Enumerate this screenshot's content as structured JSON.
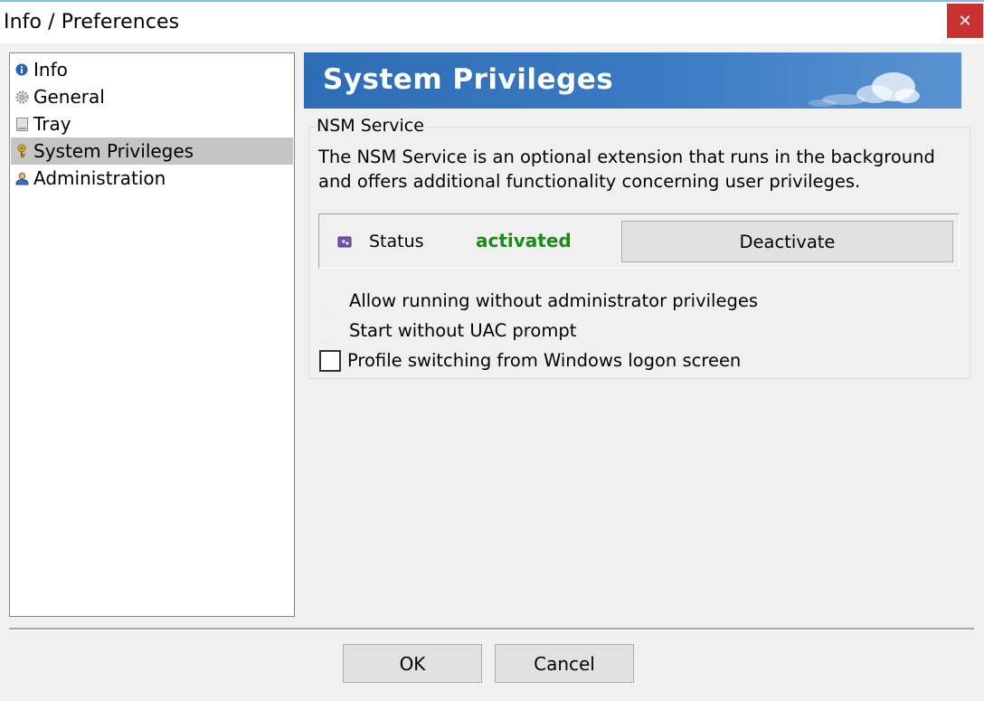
{
  "window": {
    "title": "Info / Preferences",
    "close_glyph": "✕"
  },
  "nav": {
    "items": [
      {
        "label": "Info",
        "icon": "info-icon"
      },
      {
        "label": "General",
        "icon": "gear-icon"
      },
      {
        "label": "Tray",
        "icon": "tray-icon"
      },
      {
        "label": "System Privileges",
        "icon": "key-icon",
        "selected": true
      },
      {
        "label": "Administration",
        "icon": "user-icon"
      }
    ]
  },
  "banner": {
    "title": "System Privileges"
  },
  "nsm": {
    "group_title": "NSM Service",
    "description": "The NSM Service is an optional extension that runs in the background and offers additional functionality concerning user privileges.",
    "status_label": "Status",
    "status_value": "activated",
    "status_color": "#1a8a1a",
    "deactivate_label": "Deactivate"
  },
  "options": {
    "allow_no_admin": "Allow running without administrator privileges",
    "start_no_uac": "Start without UAC prompt",
    "profile_switching": "Profile switching from Windows logon screen"
  },
  "footer": {
    "ok_label": "OK",
    "cancel_label": "Cancel"
  }
}
